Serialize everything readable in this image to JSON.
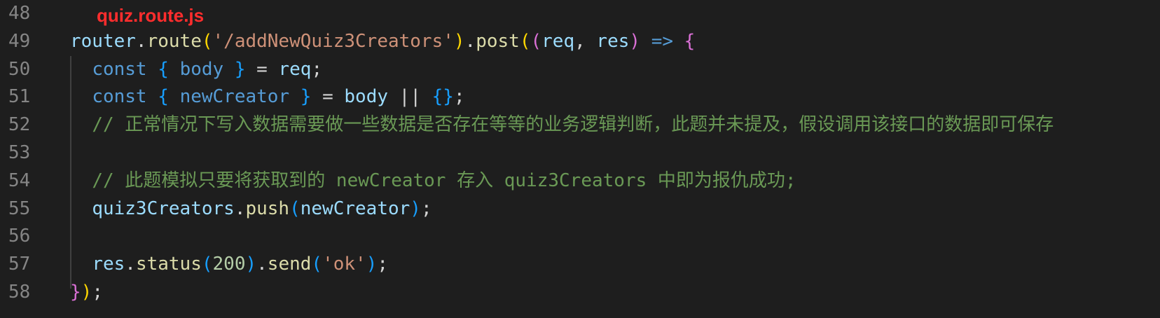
{
  "file_label": "quiz.route.js",
  "lines": [
    {
      "number": "48",
      "tokens": []
    },
    {
      "number": "49",
      "tokens": [
        {
          "t": "router",
          "c": "var"
        },
        {
          "t": ".",
          "c": "op"
        },
        {
          "t": "route",
          "c": "fn"
        },
        {
          "t": "(",
          "c": "p1"
        },
        {
          "t": "'/addNewQuiz3Creators'",
          "c": "str"
        },
        {
          "t": ")",
          "c": "p1"
        },
        {
          "t": ".",
          "c": "op"
        },
        {
          "t": "post",
          "c": "fn"
        },
        {
          "t": "(",
          "c": "p1"
        },
        {
          "t": "(",
          "c": "p2"
        },
        {
          "t": "req",
          "c": "var"
        },
        {
          "t": ", ",
          "c": "op"
        },
        {
          "t": "res",
          "c": "var"
        },
        {
          "t": ")",
          "c": "p2"
        },
        {
          "t": " ",
          "c": "op"
        },
        {
          "t": "=>",
          "c": "kw"
        },
        {
          "t": " ",
          "c": "op"
        },
        {
          "t": "{",
          "c": "p2"
        }
      ]
    },
    {
      "number": "50",
      "tokens": [
        {
          "t": "  ",
          "c": "op"
        },
        {
          "t": "const",
          "c": "kw"
        },
        {
          "t": " ",
          "c": "op"
        },
        {
          "t": "{",
          "c": "p3"
        },
        {
          "t": " ",
          "c": "op"
        },
        {
          "t": "body",
          "c": "kw"
        },
        {
          "t": " ",
          "c": "op"
        },
        {
          "t": "}",
          "c": "p3"
        },
        {
          "t": " = ",
          "c": "op"
        },
        {
          "t": "req",
          "c": "var"
        },
        {
          "t": ";",
          "c": "op"
        }
      ]
    },
    {
      "number": "51",
      "tokens": [
        {
          "t": "  ",
          "c": "op"
        },
        {
          "t": "const",
          "c": "kw"
        },
        {
          "t": " ",
          "c": "op"
        },
        {
          "t": "{",
          "c": "p3"
        },
        {
          "t": " ",
          "c": "op"
        },
        {
          "t": "newCreator",
          "c": "kw"
        },
        {
          "t": " ",
          "c": "op"
        },
        {
          "t": "}",
          "c": "p3"
        },
        {
          "t": " = ",
          "c": "op"
        },
        {
          "t": "body",
          "c": "var"
        },
        {
          "t": " || ",
          "c": "op"
        },
        {
          "t": "{}",
          "c": "p3"
        },
        {
          "t": ";",
          "c": "op"
        }
      ]
    },
    {
      "number": "52",
      "tokens": [
        {
          "t": "  ",
          "c": "op"
        },
        {
          "t": "// 正常情况下写入数据需要做一些数据是否存在等等的业务逻辑判断，此题并未提及，假设调用该接口的数据即可保存",
          "c": "cmt"
        }
      ]
    },
    {
      "number": "53",
      "tokens": []
    },
    {
      "number": "54",
      "tokens": [
        {
          "t": "  ",
          "c": "op"
        },
        {
          "t": "// 此题模拟只要将获取到的 newCreator 存入 quiz3Creators 中即为报仇成功;",
          "c": "cmt"
        }
      ]
    },
    {
      "number": "55",
      "tokens": [
        {
          "t": "  ",
          "c": "op"
        },
        {
          "t": "quiz3Creators",
          "c": "var"
        },
        {
          "t": ".",
          "c": "op"
        },
        {
          "t": "push",
          "c": "fn"
        },
        {
          "t": "(",
          "c": "p3"
        },
        {
          "t": "newCreator",
          "c": "var"
        },
        {
          "t": ")",
          "c": "p3"
        },
        {
          "t": ";",
          "c": "op"
        }
      ]
    },
    {
      "number": "56",
      "tokens": []
    },
    {
      "number": "57",
      "tokens": [
        {
          "t": "  ",
          "c": "op"
        },
        {
          "t": "res",
          "c": "var"
        },
        {
          "t": ".",
          "c": "op"
        },
        {
          "t": "status",
          "c": "fn"
        },
        {
          "t": "(",
          "c": "p3"
        },
        {
          "t": "200",
          "c": "num"
        },
        {
          "t": ")",
          "c": "p3"
        },
        {
          "t": ".",
          "c": "op"
        },
        {
          "t": "send",
          "c": "fn"
        },
        {
          "t": "(",
          "c": "p3"
        },
        {
          "t": "'ok'",
          "c": "str"
        },
        {
          "t": ")",
          "c": "p3"
        },
        {
          "t": ";",
          "c": "op"
        }
      ]
    },
    {
      "number": "58",
      "tokens": [
        {
          "t": "}",
          "c": "p2"
        },
        {
          "t": ")",
          "c": "p1"
        },
        {
          "t": ";",
          "c": "op"
        }
      ]
    }
  ]
}
